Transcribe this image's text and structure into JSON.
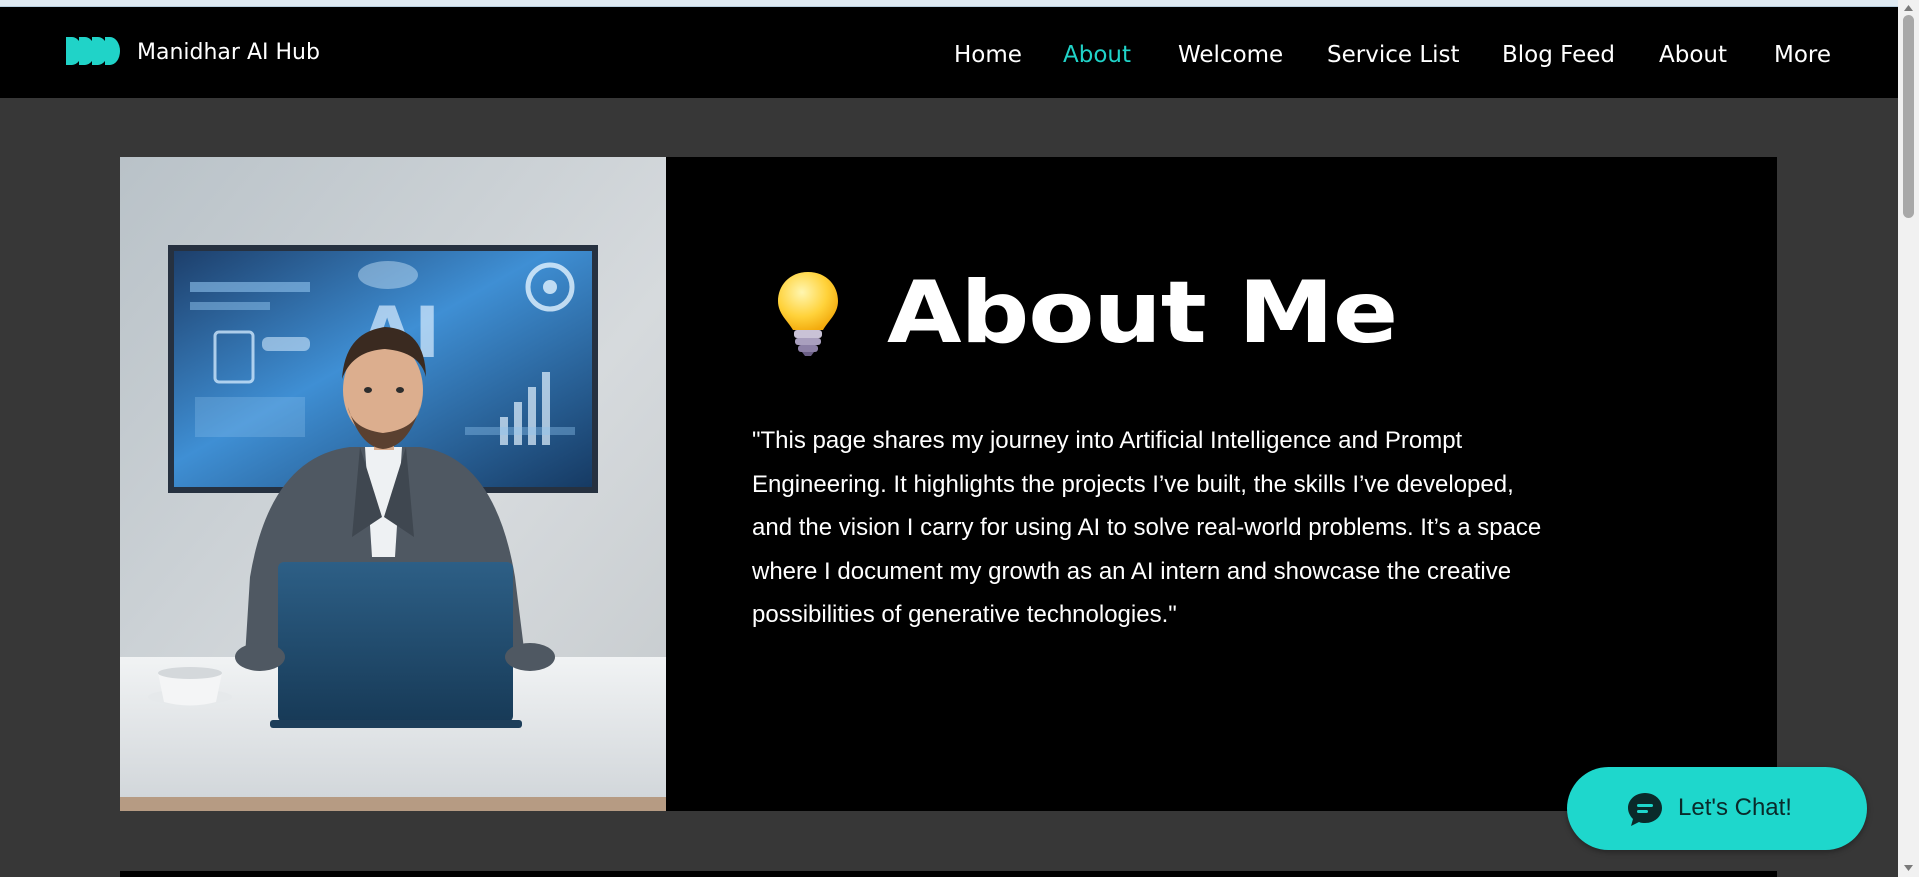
{
  "header": {
    "site_name": "Manidhar AI Hub",
    "nav": [
      {
        "label": "Home",
        "active": false
      },
      {
        "label": "About",
        "active": true
      },
      {
        "label": "Welcome",
        "active": false
      },
      {
        "label": "Service List",
        "active": false
      },
      {
        "label": "Blog Feed",
        "active": false
      },
      {
        "label": "About",
        "active": false
      },
      {
        "label": "More",
        "active": false
      }
    ]
  },
  "about": {
    "heading": "About Me",
    "icon": "light-bulb-icon",
    "paragraph": "\"This page shares my journey into Artificial Intelligence and Prompt Engineering. It highlights the projects I’ve built, the skills I’ve developed, and the vision I carry for using AI to solve real-world problems. It’s a space where I document my growth as an AI intern and showcase the creative possibilities of generative technologies.\""
  },
  "chat": {
    "label": "Let's Chat!",
    "icon": "chat-bubble-icon"
  },
  "colors": {
    "accent": "#20d3c8",
    "header_bg": "#000000",
    "page_bg": "#373737",
    "chat_bg": "#1ed7cc"
  }
}
